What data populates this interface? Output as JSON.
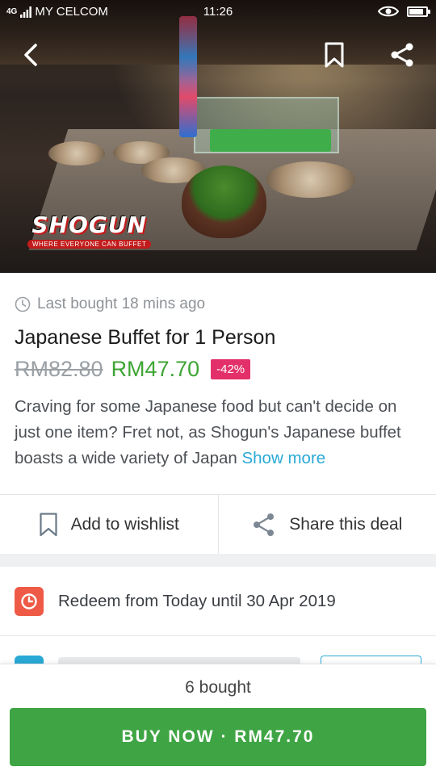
{
  "status_bar": {
    "signal_prefix": "4G",
    "carrier": "MY CELCOM",
    "time": "11:26",
    "battery_level": 0.85
  },
  "header": {
    "back_icon": "chevron-left-icon",
    "bookmark_icon": "bookmark-icon",
    "share_icon": "share-icon"
  },
  "hero": {
    "logo_text": "SHOGUN",
    "logo_tagline": "WHERE EVERYONE CAN BUFFET"
  },
  "deal": {
    "last_bought": "Last bought 18 mins ago",
    "title": "Japanese Buffet for 1 Person",
    "original_price": "RM82.80",
    "price": "RM47.70",
    "discount": "-42%",
    "description": "Craving for some Japanese food but can't decide on just one item? Fret not, as Shogun's Japanese buffet boasts a wide variety of Japan",
    "show_more": "Show more"
  },
  "actions": {
    "wishlist_label": "Add to wishlist",
    "share_label": "Share this deal"
  },
  "redeem": {
    "text": "Redeem from Today until 30 Apr 2019"
  },
  "footer": {
    "bought_count": "6 bought",
    "buy_label": "BUY NOW · RM47.70"
  },
  "colors": {
    "green": "#3fa544",
    "price_green": "#3fa535",
    "discount_pink": "#e3306a",
    "link_blue": "#2aa9d6",
    "calendar_red": "#ee5a46"
  }
}
